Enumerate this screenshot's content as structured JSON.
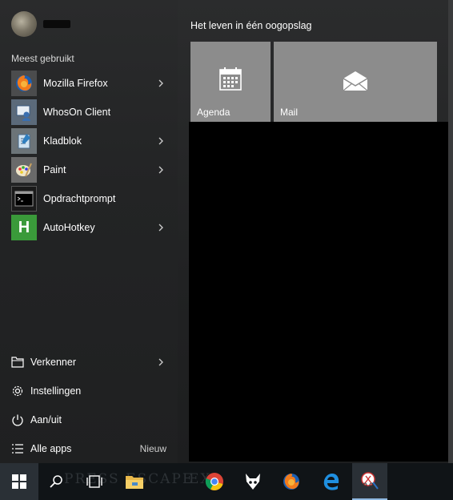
{
  "user": {
    "name": "",
    "avatar_icon": "user-avatar"
  },
  "left_panel": {
    "section_title": "Meest gebruikt",
    "apps": [
      {
        "label": "Mozilla Firefox",
        "icon": "firefox-icon",
        "has_submenu": true
      },
      {
        "label": "WhosOn Client",
        "icon": "whoson-icon",
        "has_submenu": false
      },
      {
        "label": "Kladblok",
        "icon": "notepad-icon",
        "has_submenu": true
      },
      {
        "label": "Paint",
        "icon": "paint-icon",
        "has_submenu": true
      },
      {
        "label": "Opdrachtprompt",
        "icon": "command-prompt-icon",
        "has_submenu": false
      },
      {
        "label": "AutoHotkey",
        "icon": "autohotkey-icon",
        "icon_glyph": "H",
        "has_submenu": true
      }
    ],
    "system_items": [
      {
        "label": "Verkenner",
        "icon": "file-explorer-icon",
        "has_submenu": true
      },
      {
        "label": "Instellingen",
        "icon": "gear-icon"
      },
      {
        "label": "Aan/uit",
        "icon": "power-icon"
      },
      {
        "label": "Alle apps",
        "icon": "list-icon",
        "badge": "Nieuw"
      }
    ]
  },
  "tiles": {
    "group_title": "Het leven in één oogopslag",
    "items": [
      {
        "label": "Agenda",
        "icon": "calendar-icon"
      },
      {
        "label": "Mail",
        "icon": "mail-icon"
      }
    ]
  },
  "taskbar": {
    "items": [
      "start-button",
      "search-icon",
      "task-view-icon",
      "file-explorer-icon",
      "chrome-icon",
      "app-icon",
      "firefox-icon",
      "edge-icon",
      "snipping-tool-icon"
    ],
    "ghost_text_left": "PRESS ESCAPE",
    "ghost_text_right": "EX"
  },
  "colors": {
    "tile": "#8c8c8c",
    "start_bg": "#1b1c1d",
    "taskbar_bg": "#101417",
    "ahk_green": "#3a9a3a"
  }
}
